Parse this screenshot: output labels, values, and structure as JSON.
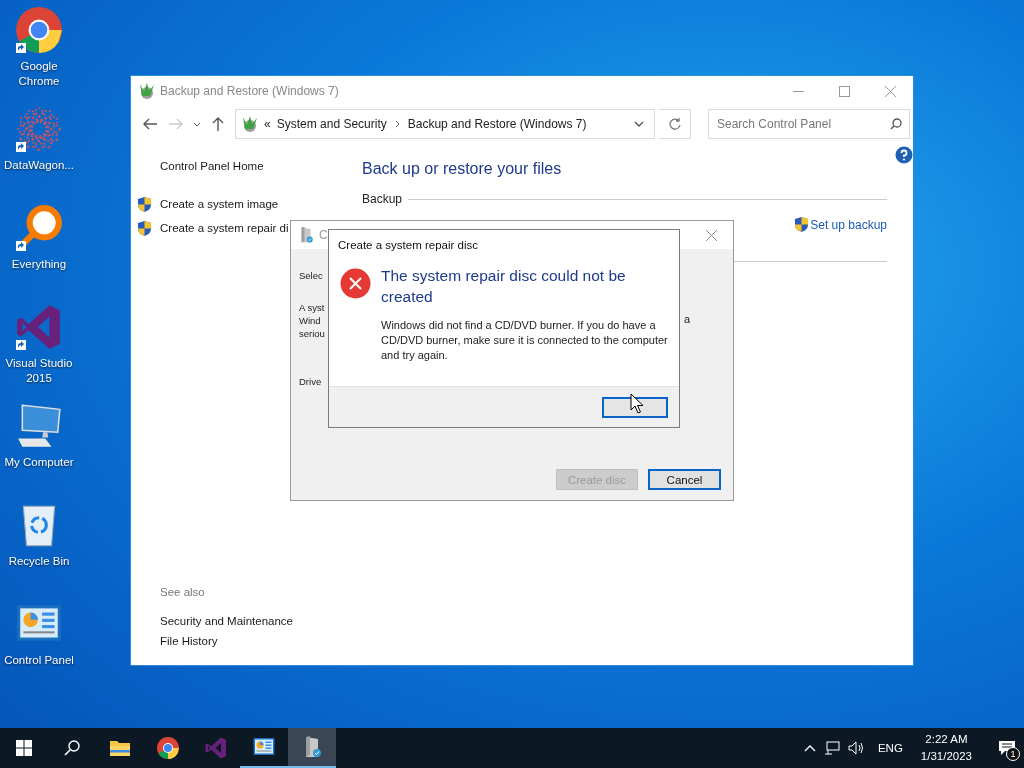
{
  "desktop_icons": [
    {
      "label": "Google Chrome",
      "kind": "chrome",
      "shortcut": true
    },
    {
      "label": "DataWagon...",
      "kind": "pattern",
      "shortcut": true
    },
    {
      "label": "Everything",
      "kind": "magnifier",
      "shortcut": true
    },
    {
      "label": "Visual Studio 2015",
      "kind": "vs",
      "shortcut": true
    },
    {
      "label": "My Computer",
      "kind": "computer",
      "shortcut": false
    },
    {
      "label": "Recycle Bin",
      "kind": "recycle",
      "shortcut": false
    },
    {
      "label": "Control Panel",
      "kind": "panel",
      "shortcut": false
    }
  ],
  "main_window": {
    "title": "Backup and Restore (Windows 7)",
    "address": {
      "overflow": "«",
      "crumbs": [
        "System and Security",
        "Backup and Restore (Windows 7)"
      ]
    },
    "search": {
      "placeholder": "Search Control Panel"
    },
    "sidebar": {
      "home": "Control Panel Home",
      "tasks": [
        "Create a system image",
        "Create a system repair di"
      ],
      "see_also_heading": "See also",
      "see_also": [
        "Security and Maintenance",
        "File History"
      ]
    },
    "heading": "Back up or restore your files",
    "section": "Backup",
    "set_up_backup": "Set up backup"
  },
  "repair_dialog": {
    "title": "C",
    "fragments": [
      "Selec",
      "A syst",
      "Wind",
      "seriou",
      "Drive"
    ],
    "right_fragment": "a",
    "buttons": [
      {
        "label": "Create disc",
        "disabled": true,
        "default": false
      },
      {
        "label": "Cancel",
        "disabled": false,
        "default": true
      }
    ]
  },
  "error_dialog": {
    "title": "Create a system repair disc",
    "heading": "The system repair disc could not be created",
    "message": "Windows did not find a CD/DVD burner. If you do have a CD/DVD burner, make sure it is connected to the computer and try again."
  },
  "taskbar": {
    "apps": [
      {
        "kind": "folder",
        "running": false,
        "selected": false
      },
      {
        "kind": "chrome",
        "running": false,
        "selected": false
      },
      {
        "kind": "vs",
        "running": false,
        "selected": false
      },
      {
        "kind": "panel",
        "running": true,
        "selected": false
      },
      {
        "kind": "disc",
        "running": true,
        "selected": true
      }
    ],
    "language": "ENG",
    "time": "2:22 AM",
    "date": "1/31/2023",
    "notifications": "1"
  }
}
